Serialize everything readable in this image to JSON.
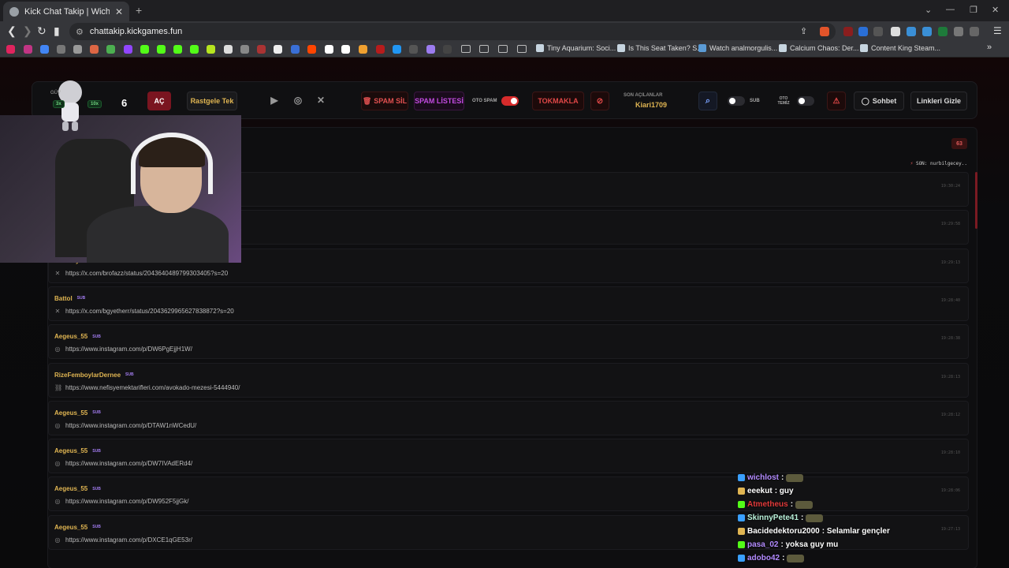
{
  "browser": {
    "tab_title": "Kick Chat Takip | Wich",
    "url": "chattakip.kickgames.fun",
    "bookmarks": [
      {
        "label": "Tiny Aquarium: Soci..."
      },
      {
        "label": "Is This Seat Taken? S..."
      },
      {
        "label": "Watch analmorgulis..."
      },
      {
        "label": "Calcium Chaos: Der..."
      },
      {
        "label": "Content King Steam..."
      }
    ]
  },
  "topbar": {
    "count": "6",
    "ac_label": "AÇ",
    "rastgele_label": "Rastgele Tek",
    "spam_sil_label": "SPAM SİL",
    "spam_listesi_label": "SPAM LİSTESİ",
    "oto_spam_label": "OTO SPAM",
    "tokmakla_label": "TOKMAKLA",
    "son_acilanlar_label": "SON AÇILANLAR",
    "son_acilanlar_value": "Kiari1709",
    "sub_label": "SUB",
    "oto_temiz_label": "OTO TEMİZ",
    "sohbet_label": "Sohbet",
    "linkleri_gizle_label": "Linkleri Gizle"
  },
  "panel": {
    "badge_count": "63",
    "son_label": "SON:",
    "son_value": "nurbilgecey..",
    "messages": [
      {
        "user": "",
        "link": "",
        "time": "19:30:24"
      },
      {
        "user": "",
        "link": "",
        "time": "19:29:58"
      },
      {
        "user": "mavwhy",
        "sub": "SUB",
        "icon": "x-icon",
        "link": "https://x.com/brofazz/status/2043640489799303405?s=20",
        "time": "19:29:13"
      },
      {
        "user": "Battol",
        "sub": "SUB",
        "icon": "x-icon",
        "link": "https://x.com/bgyetherr/status/2043629965627838872?s=20",
        "time": "19:28:40"
      },
      {
        "user": "Aegeus_55",
        "sub": "SUB",
        "icon": "instagram-icon",
        "link": "https://www.instagram.com/p/DW6PgEjjH1W/",
        "time": "19:28:38"
      },
      {
        "user": "RizeFemboylarDernee",
        "sub": "SUB",
        "icon": "link-icon",
        "link": "https://www.nefisyemektarifleri.com/avokado-mezesi-5444940/",
        "time": "19:28:13"
      },
      {
        "user": "Aegeus_55",
        "sub": "SUB",
        "icon": "instagram-icon",
        "link": "https://www.instagram.com/p/DTAW1nWCedU/",
        "time": "19:28:12"
      },
      {
        "user": "Aegeus_55",
        "sub": "SUB",
        "icon": "instagram-icon",
        "link": "https://www.instagram.com/p/DW7IVAdERd4/",
        "time": "19:28:10"
      },
      {
        "user": "Aegeus_55",
        "sub": "SUB",
        "icon": "instagram-icon",
        "link": "https://www.instagram.com/p/DW952F5jjGk/",
        "time": "19:28:06"
      },
      {
        "user": "Aegeus_55",
        "sub": "SUB",
        "icon": "instagram-icon",
        "link": "https://www.instagram.com/p/DXCE1qGE53r/",
        "time": "19:27:13"
      }
    ]
  },
  "overlay": {
    "mascot_label": "GÜV",
    "chip_left": "3x",
    "chip_right": "10x",
    "chat": [
      {
        "user": "wichlost",
        "text": ":",
        "color": "#b38bff"
      },
      {
        "user": "eeekut",
        "text": ": guy",
        "color": "#ffffff"
      },
      {
        "user": "Atmetheus",
        "text": ":",
        "color": "#e03a3a"
      },
      {
        "user": "SkinnyPete41",
        "text": ":",
        "color": "#b8f0d8"
      },
      {
        "user": "Bacidedektoru2000",
        "text": ": Selamlar gençler",
        "color": "#ffffff"
      },
      {
        "user": "pasa_02",
        "text": ": yoksa guy mu",
        "color": "#b38bff"
      },
      {
        "user": "adobo42",
        "text": ":",
        "color": "#b38bff"
      }
    ]
  }
}
